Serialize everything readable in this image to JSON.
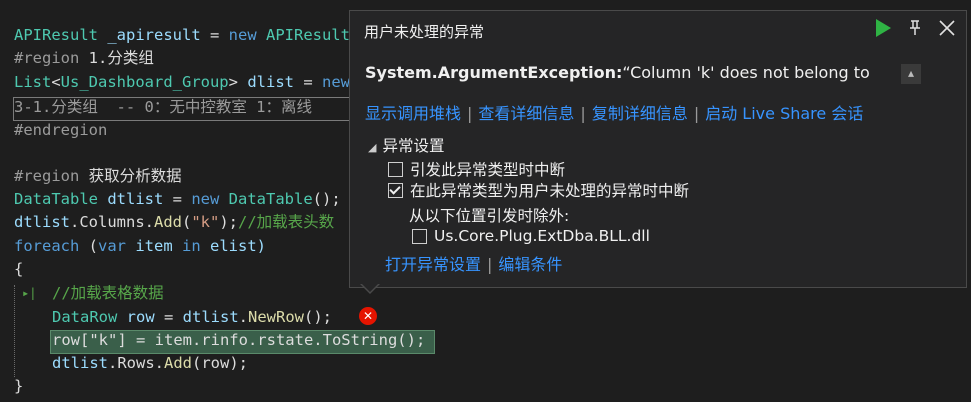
{
  "code": {
    "l1": {
      "a": "APIResult ",
      "b": "_apiresult",
      "c": " = ",
      "d": "new",
      "e": " APIResult"
    },
    "l2": {
      "a": "#region ",
      "b": "1.分类组"
    },
    "l3": {
      "a": "List",
      "b": "<",
      "c": "Us_Dashboard_Group",
      "d": "> ",
      "e": "dlist",
      "f": " = ",
      "g": "new"
    },
    "l4": {
      "a": "3-1.分类组  -- 0：无中控教室 1：离线"
    },
    "l5": {
      "a": "#endregion"
    },
    "l6": {
      "a": "#region ",
      "b": "获取分析数据"
    },
    "l7": {
      "a": "DataTable ",
      "b": "dtlist",
      "c": " = ",
      "d": "new",
      "e": " DataTable",
      "f": "();"
    },
    "l8": {
      "a": "dtlist",
      "b": ".Columns.",
      "c": "Add",
      "d": "(",
      "e": "\"k\"",
      "f": ");",
      "g": "//加载表头数"
    },
    "l9": {
      "a": "foreach",
      "b": " (",
      "c": "var",
      "d": " item ",
      "e": "in",
      "f": " elist)"
    },
    "l10": {
      "a": "{"
    },
    "l11": {
      "a": "//加载表格数据"
    },
    "l12": {
      "a": "DataRow ",
      "b": "row",
      "c": " = ",
      "d": "dtlist",
      "e": ".",
      "f": "NewRow",
      "g": "();"
    },
    "l13": {
      "a": "row[\"k\"] = item.rinfo.rstate.ToString();"
    },
    "l14": {
      "a": "dtlist",
      "b": ".Rows.",
      "c": "Add",
      "d": "(row);"
    },
    "l15": {
      "a": "}"
    }
  },
  "popup": {
    "title": "用户未处理的异常",
    "exception_type": "System.ArgumentException:",
    "exception_message": "“Column 'k' does not belong to",
    "links": [
      "显示调用堆栈",
      "查看详细信息",
      "复制详细信息",
      "启动 Live Share 会话"
    ],
    "section_title": "异常设置",
    "option1": "引发此异常类型时中断",
    "option2": "在此异常类型为用户未处理的异常时中断",
    "except_label": "从以下位置引发时除外:",
    "module": "Us.Core.Plug.ExtDba.BLL.dll",
    "bottom_links": [
      "打开异常设置",
      "编辑条件"
    ],
    "option1_checked": false,
    "option2_checked": true,
    "module_checked": false
  },
  "colors": {
    "accent": "#3794ff",
    "play": "#2fb344",
    "error": "#e51400"
  }
}
